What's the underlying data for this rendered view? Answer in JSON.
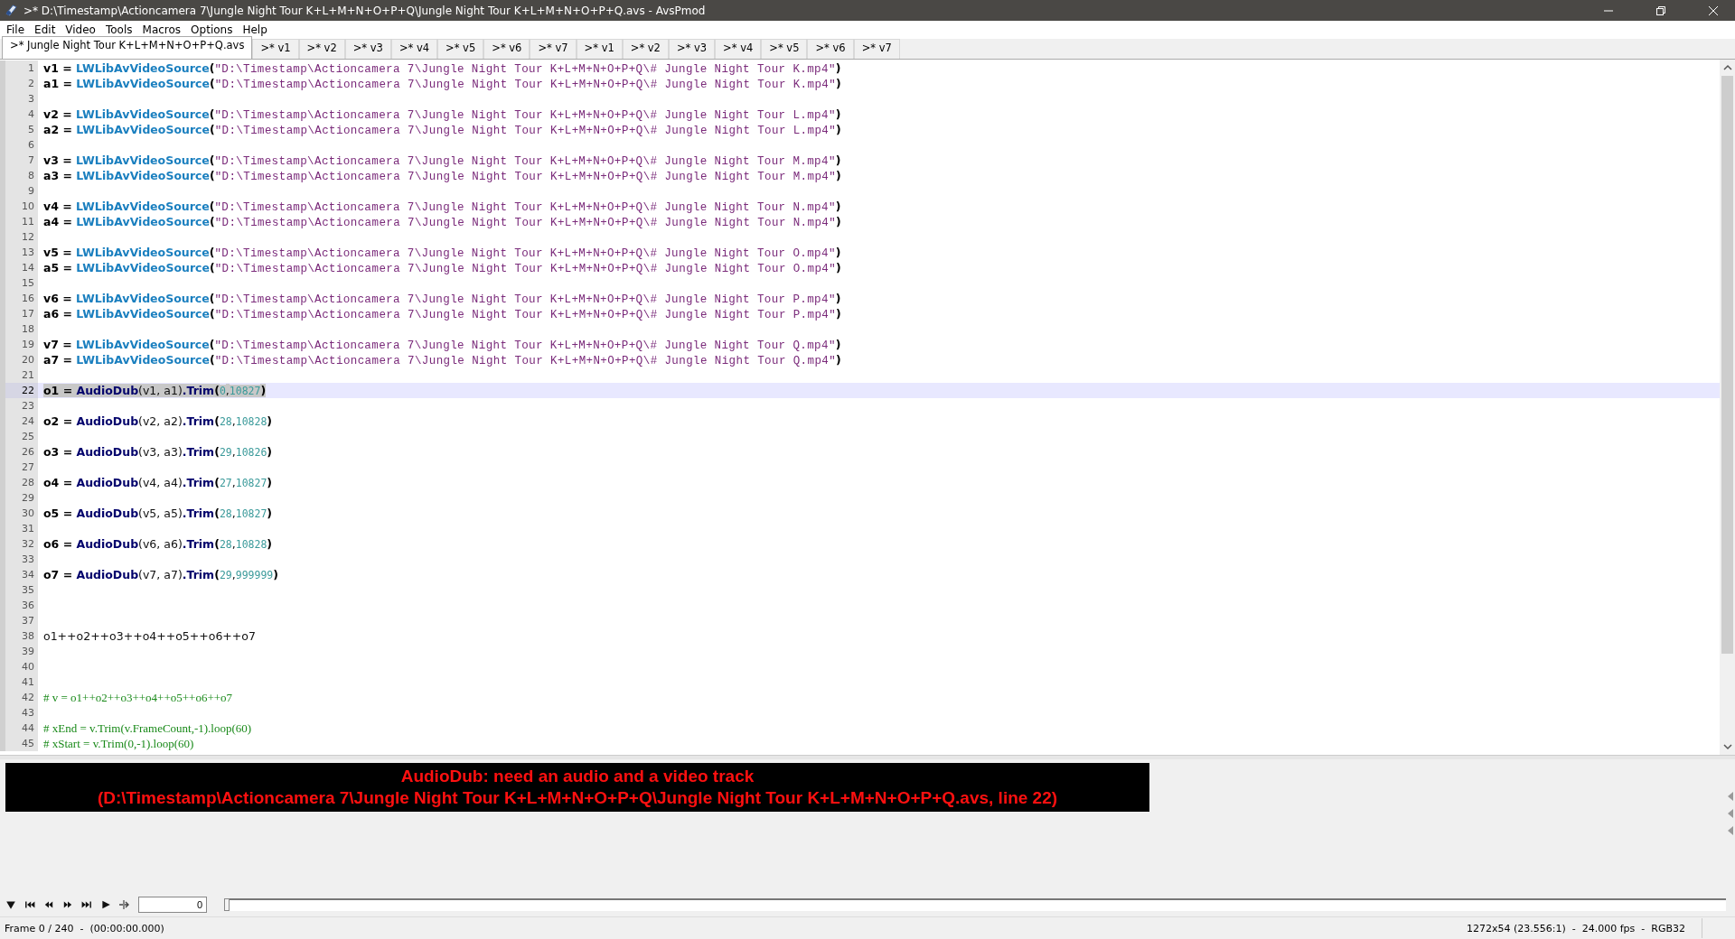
{
  "window": {
    "title": ">* D:\\Timestamp\\Actioncamera 7\\Jungle Night Tour K+L+M+N+O+P+Q\\Jungle Night Tour K+L+M+N+O+P+Q.avs - AvsPmod"
  },
  "menu": [
    "File",
    "Edit",
    "Video",
    "Tools",
    "Macros",
    "Options",
    "Help"
  ],
  "tabs": [
    {
      "label": ">* Jungle Night Tour K+L+M+N+O+P+Q.avs",
      "selected": true
    },
    {
      "label": ">* v1",
      "selected": false
    },
    {
      "label": ">* v2",
      "selected": false
    },
    {
      "label": ">* v3",
      "selected": false
    },
    {
      "label": ">* v4",
      "selected": false
    },
    {
      "label": ">* v5",
      "selected": false
    },
    {
      "label": ">* v6",
      "selected": false
    },
    {
      "label": ">* v7",
      "selected": false
    },
    {
      "label": ">* v1",
      "selected": false
    },
    {
      "label": ">* v2",
      "selected": false
    },
    {
      "label": ">* v3",
      "selected": false
    },
    {
      "label": ">* v4",
      "selected": false
    },
    {
      "label": ">* v5",
      "selected": false
    },
    {
      "label": ">* v6",
      "selected": false
    },
    {
      "label": ">* v7",
      "selected": false
    }
  ],
  "editor": {
    "lines": [
      {
        "number": "1",
        "current": false,
        "parts": [
          {
            "kind": "kw",
            "text": "v1 = "
          },
          {
            "kind": "func",
            "text": "LWLibAvVideoSource"
          },
          {
            "kind": "kw",
            "text": "("
          },
          {
            "kind": "str",
            "text": "\"D:\\Timestamp\\Actioncamera 7\\Jungle Night Tour K+L+M+N+O+P+Q\\# Jungle Night Tour K.mp4\""
          },
          {
            "kind": "kw",
            "text": ")"
          }
        ]
      },
      {
        "number": "2",
        "current": false,
        "parts": [
          {
            "kind": "kw",
            "text": "a1 = "
          },
          {
            "kind": "func",
            "text": "LWLibAvVideoSource"
          },
          {
            "kind": "kw",
            "text": "("
          },
          {
            "kind": "str",
            "text": "\"D:\\Timestamp\\Actioncamera 7\\Jungle Night Tour K+L+M+N+O+P+Q\\# Jungle Night Tour K.mp4\""
          },
          {
            "kind": "kw",
            "text": ")"
          }
        ]
      },
      {
        "number": "3",
        "current": false
      },
      {
        "number": "4",
        "current": false,
        "parts": [
          {
            "kind": "kw",
            "text": "v2 = "
          },
          {
            "kind": "func",
            "text": "LWLibAvVideoSource"
          },
          {
            "kind": "kw",
            "text": "("
          },
          {
            "kind": "str",
            "text": "\"D:\\Timestamp\\Actioncamera 7\\Jungle Night Tour K+L+M+N+O+P+Q\\# Jungle Night Tour L.mp4\""
          },
          {
            "kind": "kw",
            "text": ")"
          }
        ]
      },
      {
        "number": "5",
        "current": false,
        "parts": [
          {
            "kind": "kw",
            "text": "a2 = "
          },
          {
            "kind": "func",
            "text": "LWLibAvVideoSource"
          },
          {
            "kind": "kw",
            "text": "("
          },
          {
            "kind": "str",
            "text": "\"D:\\Timestamp\\Actioncamera 7\\Jungle Night Tour K+L+M+N+O+P+Q\\# Jungle Night Tour L.mp4\""
          },
          {
            "kind": "kw",
            "text": ")"
          }
        ]
      },
      {
        "number": "6",
        "current": false
      },
      {
        "number": "7",
        "current": false,
        "parts": [
          {
            "kind": "kw",
            "text": "v3 = "
          },
          {
            "kind": "func",
            "text": "LWLibAvVideoSource"
          },
          {
            "kind": "kw",
            "text": "("
          },
          {
            "kind": "str",
            "text": "\"D:\\Timestamp\\Actioncamera 7\\Jungle Night Tour K+L+M+N+O+P+Q\\# Jungle Night Tour M.mp4\""
          },
          {
            "kind": "kw",
            "text": ")"
          }
        ]
      },
      {
        "number": "8",
        "current": false,
        "parts": [
          {
            "kind": "kw",
            "text": "a3 = "
          },
          {
            "kind": "func",
            "text": "LWLibAvVideoSource"
          },
          {
            "kind": "kw",
            "text": "("
          },
          {
            "kind": "str",
            "text": "\"D:\\Timestamp\\Actioncamera 7\\Jungle Night Tour K+L+M+N+O+P+Q\\# Jungle Night Tour M.mp4\""
          },
          {
            "kind": "kw",
            "text": ")"
          }
        ]
      },
      {
        "number": "9",
        "current": false
      },
      {
        "number": "10",
        "current": false,
        "parts": [
          {
            "kind": "kw",
            "text": "v4 = "
          },
          {
            "kind": "func",
            "text": "LWLibAvVideoSource"
          },
          {
            "kind": "kw",
            "text": "("
          },
          {
            "kind": "str",
            "text": "\"D:\\Timestamp\\Actioncamera 7\\Jungle Night Tour K+L+M+N+O+P+Q\\# Jungle Night Tour N.mp4\""
          },
          {
            "kind": "kw",
            "text": ")"
          }
        ]
      },
      {
        "number": "11",
        "current": false,
        "parts": [
          {
            "kind": "kw",
            "text": "a4 = "
          },
          {
            "kind": "func",
            "text": "LWLibAvVideoSource"
          },
          {
            "kind": "kw",
            "text": "("
          },
          {
            "kind": "str",
            "text": "\"D:\\Timestamp\\Actioncamera 7\\Jungle Night Tour K+L+M+N+O+P+Q\\# Jungle Night Tour N.mp4\""
          },
          {
            "kind": "kw",
            "text": ")"
          }
        ]
      },
      {
        "number": "12",
        "current": false
      },
      {
        "number": "13",
        "current": false,
        "parts": [
          {
            "kind": "kw",
            "text": "v5 = "
          },
          {
            "kind": "func",
            "text": "LWLibAvVideoSource"
          },
          {
            "kind": "kw",
            "text": "("
          },
          {
            "kind": "str",
            "text": "\"D:\\Timestamp\\Actioncamera 7\\Jungle Night Tour K+L+M+N+O+P+Q\\# Jungle Night Tour O.mp4\""
          },
          {
            "kind": "kw",
            "text": ")"
          }
        ]
      },
      {
        "number": "14",
        "current": false,
        "parts": [
          {
            "kind": "kw",
            "text": "a5 = "
          },
          {
            "kind": "func",
            "text": "LWLibAvVideoSource"
          },
          {
            "kind": "kw",
            "text": "("
          },
          {
            "kind": "str",
            "text": "\"D:\\Timestamp\\Actioncamera 7\\Jungle Night Tour K+L+M+N+O+P+Q\\# Jungle Night Tour O.mp4\""
          },
          {
            "kind": "kw",
            "text": ")"
          }
        ]
      },
      {
        "number": "15",
        "current": false
      },
      {
        "number": "16",
        "current": false,
        "parts": [
          {
            "kind": "kw",
            "text": "v6 = "
          },
          {
            "kind": "func",
            "text": "LWLibAvVideoSource"
          },
          {
            "kind": "kw",
            "text": "("
          },
          {
            "kind": "str",
            "text": "\"D:\\Timestamp\\Actioncamera 7\\Jungle Night Tour K+L+M+N+O+P+Q\\# Jungle Night Tour P.mp4\""
          },
          {
            "kind": "kw",
            "text": ")"
          }
        ]
      },
      {
        "number": "17",
        "current": false,
        "parts": [
          {
            "kind": "kw",
            "text": "a6 = "
          },
          {
            "kind": "func",
            "text": "LWLibAvVideoSource"
          },
          {
            "kind": "kw",
            "text": "("
          },
          {
            "kind": "str",
            "text": "\"D:\\Timestamp\\Actioncamera 7\\Jungle Night Tour K+L+M+N+O+P+Q\\# Jungle Night Tour P.mp4\""
          },
          {
            "kind": "kw",
            "text": ")"
          }
        ]
      },
      {
        "number": "18",
        "current": false
      },
      {
        "number": "19",
        "current": false,
        "parts": [
          {
            "kind": "kw",
            "text": "v7 = "
          },
          {
            "kind": "func",
            "text": "LWLibAvVideoSource"
          },
          {
            "kind": "kw",
            "text": "("
          },
          {
            "kind": "str",
            "text": "\"D:\\Timestamp\\Actioncamera 7\\Jungle Night Tour K+L+M+N+O+P+Q\\# Jungle Night Tour Q.mp4\""
          },
          {
            "kind": "kw",
            "text": ")"
          }
        ]
      },
      {
        "number": "20",
        "current": false,
        "parts": [
          {
            "kind": "kw",
            "text": "a7 = "
          },
          {
            "kind": "func",
            "text": "LWLibAvVideoSource"
          },
          {
            "kind": "kw",
            "text": "("
          },
          {
            "kind": "str",
            "text": "\"D:\\Timestamp\\Actioncamera 7\\Jungle Night Tour K+L+M+N+O+P+Q\\# Jungle Night Tour Q.mp4\""
          },
          {
            "kind": "kw",
            "text": ")"
          }
        ]
      },
      {
        "number": "21",
        "current": false
      },
      {
        "number": "22",
        "current": true,
        "parts": [
          {
            "kind": "kw",
            "text": "o1 = "
          },
          {
            "kind": "call",
            "text": "AudioDub"
          },
          {
            "kind": "plain",
            "text": "(v1, a1)"
          },
          {
            "kind": "call",
            "text": ".Trim"
          },
          {
            "kind": "kw",
            "text": "("
          },
          {
            "kind": "num",
            "text": "0"
          },
          {
            "kind": "plain",
            "text": ","
          },
          {
            "kind": "num",
            "text": "10827"
          },
          {
            "kind": "kw",
            "text": ")"
          }
        ]
      },
      {
        "number": "23",
        "current": false
      },
      {
        "number": "24",
        "current": false,
        "parts": [
          {
            "kind": "kw",
            "text": "o2 = "
          },
          {
            "kind": "call",
            "text": "AudioDub"
          },
          {
            "kind": "plain",
            "text": "(v2, a2)"
          },
          {
            "kind": "call",
            "text": ".Trim"
          },
          {
            "kind": "kw",
            "text": "("
          },
          {
            "kind": "num",
            "text": "28"
          },
          {
            "kind": "plain",
            "text": ","
          },
          {
            "kind": "num",
            "text": "10828"
          },
          {
            "kind": "kw",
            "text": ")"
          }
        ]
      },
      {
        "number": "25",
        "current": false
      },
      {
        "number": "26",
        "current": false,
        "parts": [
          {
            "kind": "kw",
            "text": "o3 = "
          },
          {
            "kind": "call",
            "text": "AudioDub"
          },
          {
            "kind": "plain",
            "text": "(v3, a3)"
          },
          {
            "kind": "call",
            "text": ".Trim"
          },
          {
            "kind": "kw",
            "text": "("
          },
          {
            "kind": "num",
            "text": "29"
          },
          {
            "kind": "plain",
            "text": ","
          },
          {
            "kind": "num",
            "text": "10826"
          },
          {
            "kind": "kw",
            "text": ")"
          }
        ]
      },
      {
        "number": "27",
        "current": false
      },
      {
        "number": "28",
        "current": false,
        "parts": [
          {
            "kind": "kw",
            "text": "o4 = "
          },
          {
            "kind": "call",
            "text": "AudioDub"
          },
          {
            "kind": "plain",
            "text": "(v4, a4)"
          },
          {
            "kind": "call",
            "text": ".Trim"
          },
          {
            "kind": "kw",
            "text": "("
          },
          {
            "kind": "num",
            "text": "27"
          },
          {
            "kind": "plain",
            "text": ","
          },
          {
            "kind": "num",
            "text": "10827"
          },
          {
            "kind": "kw",
            "text": ")"
          }
        ]
      },
      {
        "number": "29",
        "current": false
      },
      {
        "number": "30",
        "current": false,
        "parts": [
          {
            "kind": "kw",
            "text": "o5 = "
          },
          {
            "kind": "call",
            "text": "AudioDub"
          },
          {
            "kind": "plain",
            "text": "(v5, a5)"
          },
          {
            "kind": "call",
            "text": ".Trim"
          },
          {
            "kind": "kw",
            "text": "("
          },
          {
            "kind": "num",
            "text": "28"
          },
          {
            "kind": "plain",
            "text": ","
          },
          {
            "kind": "num",
            "text": "10827"
          },
          {
            "kind": "kw",
            "text": ")"
          }
        ]
      },
      {
        "number": "31",
        "current": false
      },
      {
        "number": "32",
        "current": false,
        "parts": [
          {
            "kind": "kw",
            "text": "o6 = "
          },
          {
            "kind": "call",
            "text": "AudioDub"
          },
          {
            "kind": "plain",
            "text": "(v6, a6)"
          },
          {
            "kind": "call",
            "text": ".Trim"
          },
          {
            "kind": "kw",
            "text": "("
          },
          {
            "kind": "num",
            "text": "28"
          },
          {
            "kind": "plain",
            "text": ","
          },
          {
            "kind": "num",
            "text": "10828"
          },
          {
            "kind": "kw",
            "text": ")"
          }
        ]
      },
      {
        "number": "33",
        "current": false
      },
      {
        "number": "34",
        "current": false,
        "parts": [
          {
            "kind": "kw",
            "text": "o7 = "
          },
          {
            "kind": "call",
            "text": "AudioDub"
          },
          {
            "kind": "plain",
            "text": "(v7, a7)"
          },
          {
            "kind": "call",
            "text": ".Trim"
          },
          {
            "kind": "kw",
            "text": "("
          },
          {
            "kind": "num",
            "text": "29"
          },
          {
            "kind": "plain",
            "text": ","
          },
          {
            "kind": "num",
            "text": "999999"
          },
          {
            "kind": "kw",
            "text": ")"
          }
        ]
      },
      {
        "number": "35",
        "current": false
      },
      {
        "number": "36",
        "current": false
      },
      {
        "number": "37",
        "current": false
      },
      {
        "number": "38",
        "current": false,
        "parts": [
          {
            "kind": "plain",
            "text": "o1++o2++o3++o4++o5++o6++o7"
          }
        ]
      },
      {
        "number": "39",
        "current": false
      },
      {
        "number": "40",
        "current": false
      },
      {
        "number": "41",
        "current": false
      },
      {
        "number": "42",
        "current": false,
        "parts": [
          {
            "kind": "comment",
            "text": "# v = o1++o2++o3++o4++o5++o6++o7"
          }
        ]
      },
      {
        "number": "43",
        "current": false
      },
      {
        "number": "44",
        "current": false,
        "parts": [
          {
            "kind": "comment",
            "text": "# xEnd = v.Trim(v.FrameCount,-1).loop(60)"
          }
        ]
      },
      {
        "number": "45",
        "current": false,
        "parts": [
          {
            "kind": "comment",
            "text": "# xStart = v.Trim(0,-1).loop(60)"
          }
        ]
      }
    ]
  },
  "error": [
    "AudioDub: need an audio and a video track",
    "(D:\\Timestamp\\Actioncamera 7\\Jungle Night Tour K+L+M+N+O+P+Q\\Jungle Night Tour K+L+M+N+O+P+Q.avs, line 22)"
  ],
  "transport": {
    "frame": "0",
    "slider": {
      "level": 0
    }
  },
  "status_bar": {
    "left": "Frame 0 / 240  -  (00:00:00.000)",
    "right": "1272x54 (23.556:1)  -  24.000 fps  -  RGB32"
  }
}
